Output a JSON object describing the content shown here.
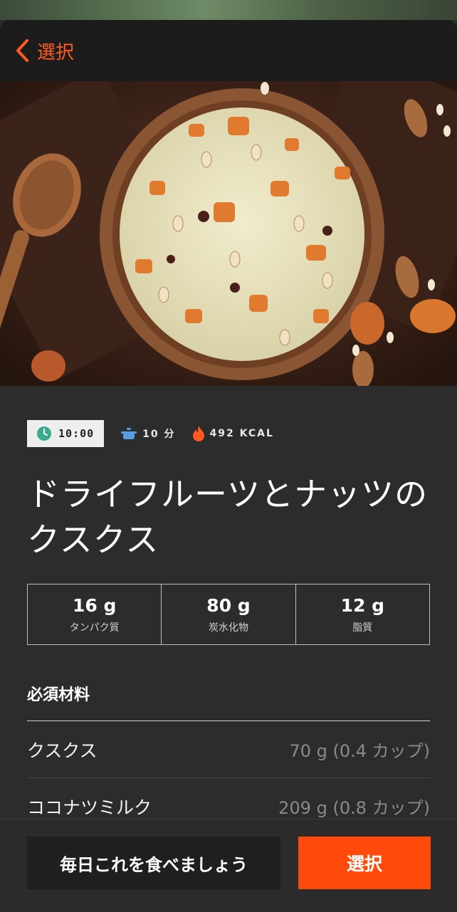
{
  "nav": {
    "back_label": "選択"
  },
  "meta": {
    "time": "10:00",
    "cook_time": "10 分",
    "calories": "492 KCAL"
  },
  "recipe": {
    "title": "ドライフルーツとナッツのクスクス"
  },
  "macros": [
    {
      "value": "16 g",
      "label": "タンパク質"
    },
    {
      "value": "80 g",
      "label": "炭水化物"
    },
    {
      "value": "12 g",
      "label": "脂質"
    }
  ],
  "ingredients": {
    "heading": "必須材料",
    "items": [
      {
        "name": "クスクス",
        "qty": "70 g (0.4 カップ)"
      },
      {
        "name": "ココナツミルク",
        "qty": "209 g (0.8 カップ)"
      }
    ]
  },
  "actions": {
    "daily_label": "毎日これを食べましょう",
    "select_label": "選択"
  },
  "colors": {
    "accent": "#ff4a0c",
    "background": "#2c2c2c",
    "nav_bg": "#1c1c1c"
  },
  "icons": {
    "back": "chevron-left-icon",
    "time": "clock-icon",
    "cook": "pot-icon",
    "calories": "flame-icon"
  }
}
